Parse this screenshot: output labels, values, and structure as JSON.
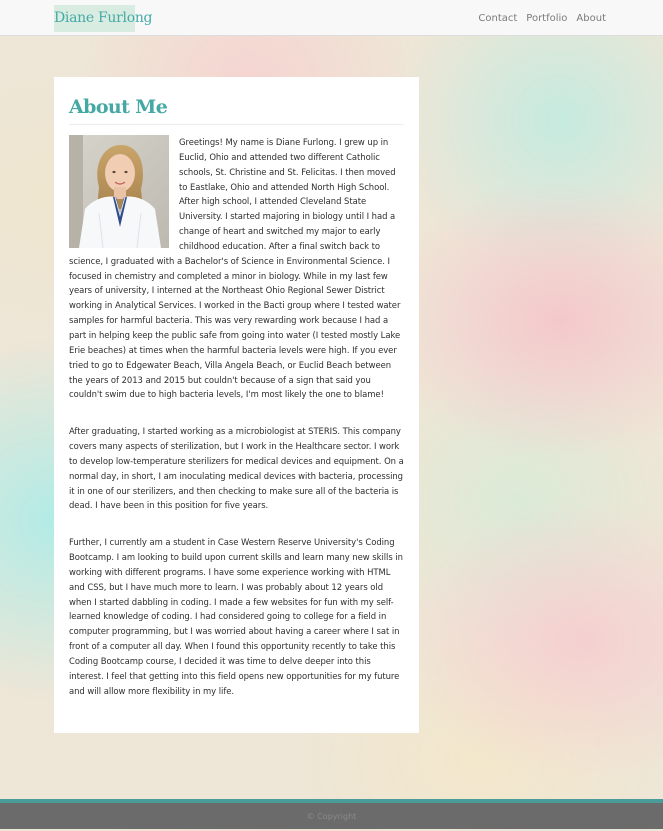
{
  "navbar": {
    "brand": "Diane Furlong",
    "links": [
      "Contact",
      "Portfolio",
      "About"
    ]
  },
  "about": {
    "title": "About Me",
    "photo_alt": "Photo of Diane Furlong in a white lab coat",
    "paragraphs": [
      "Greetings! My name is Diane Furlong. I grew up in Euclid, Ohio and attended two different Catholic schools, St. Christine and St. Felicitas. I then moved to Eastlake, Ohio and attended North High School. After high school, I attended Cleveland State University. I started majoring in biology until I had a change of heart and switched my major to early childhood education. After a final switch back to science, I graduated with a Bachelor's of Science in Environmental Science. I focused in chemistry and completed a minor in biology. While in my last few years of university, I interned at the Northeast Ohio Regional Sewer District working in Analytical Services. I worked in the Bacti group where I tested water samples for harmful bacteria. This was very rewarding work because I had a part in helping keep the public safe from going into water (I tested mostly Lake Erie beaches) at times when the harmful bacteria levels were high. If you ever tried to go to Edgewater Beach, Villa Angela Beach, or Euclid Beach between the years of 2013 and 2015 but couldn't because of a sign that said you couldn't swim due to high bacteria levels, I'm most likely the one to blame!",
      "After graduating, I started working as a microbiologist at STERIS. This company covers many aspects of sterilization, but I work in the Healthcare sector. I work to develop low-temperature sterilizers for medical devices and equipment. On a normal day, in short, I am inoculating medical devices with bacteria, processing it in one of our sterilizers, and then checking to make sure all of the bacteria is dead. I have been in this position for five years.",
      "Further, I currently am a student in Case Western Reserve University's Coding Bootcamp. I am looking to build upon current skills and learn many new skills in working with different programs. I have some experience working with HTML and CSS, but I have much more to learn. I was probably about 12 years old when I started dabbling in coding. I made a few websites for fun with my self-learned knowledge of coding. I had considered going to college for a field in computer programming, but I was worried about having a career where I sat in front of a computer all day. When I found this opportunity recently to take this Coding Bootcamp course, I decided it was time to delve deeper into this interest. I feel that getting into this field opens new opportunities for my future and will allow more flexibility in my life."
    ]
  },
  "footer": {
    "text": "© Copyright"
  },
  "colors": {
    "accent": "#46a8a4",
    "footer_band": "#4a9c98",
    "footer_bg": "#6b6b6b"
  }
}
